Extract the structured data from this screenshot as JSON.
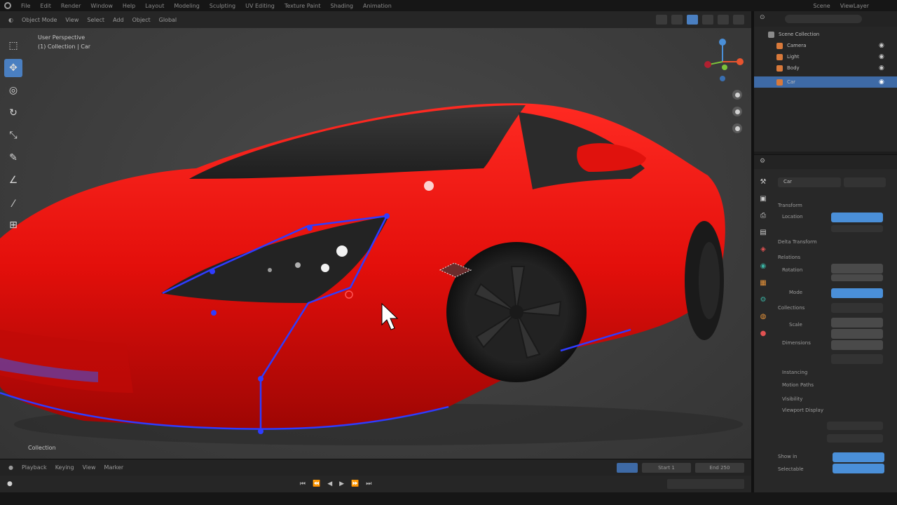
{
  "app": {
    "accent": "#4a8fd8",
    "active_tool": "select-box"
  },
  "topbar": {
    "menus": [
      "File",
      "Edit",
      "Render",
      "Window",
      "Help",
      "Layout",
      "Modeling",
      "Sculpting",
      "UV Editing",
      "Texture Paint",
      "Shading",
      "Animation"
    ],
    "scene_label": "Scene",
    "view_layer_label": "ViewLayer"
  },
  "viewport_header": {
    "menus": [
      "Object Mode",
      "View",
      "Select",
      "Add",
      "Object",
      "Global"
    ]
  },
  "viewport": {
    "info_line1": "User Perspective",
    "info_line2": "(1) Collection | Car",
    "footer_label": "Collection"
  },
  "toolbar": {
    "tools": [
      {
        "name": "select-box",
        "glyph": "⬚"
      },
      {
        "name": "cursor",
        "glyph": "✥"
      },
      {
        "name": "move",
        "glyph": "◎"
      },
      {
        "name": "rotate",
        "glyph": "↻"
      },
      {
        "name": "scale",
        "glyph": "⤡"
      },
      {
        "name": "transform",
        "glyph": "✎"
      },
      {
        "name": "annotate",
        "glyph": "∠"
      },
      {
        "name": "measure",
        "glyph": "⁄"
      },
      {
        "name": "add-cube",
        "glyph": "⊞"
      }
    ]
  },
  "timeline": {
    "labels": [
      "Playback",
      "Keying",
      "View",
      "Marker"
    ],
    "frame_start": "Start 1",
    "frame_end": "End 250"
  },
  "outliner": {
    "items": [
      {
        "label": "Scene Collection",
        "selected": false
      },
      {
        "label": "Camera",
        "selected": false
      },
      {
        "label": "Light",
        "selected": false
      },
      {
        "label": "Body",
        "selected": false
      },
      {
        "label": "Car",
        "selected": true
      }
    ]
  },
  "properties": {
    "header": "Car",
    "sections": [
      "Transform",
      "Delta Transform",
      "Relations",
      "Collections",
      "Instancing",
      "Motion Paths",
      "Visibility",
      "Viewport Display"
    ],
    "fields": [
      {
        "label": "Location",
        "style": "blue"
      },
      {
        "label": "Rotation",
        "style": "normal"
      },
      {
        "label": "Mode",
        "style": "blue"
      },
      {
        "label": "Scale",
        "style": "normal"
      },
      {
        "label": "Dimensions",
        "style": "normal"
      },
      {
        "label": "Show in",
        "style": "blue"
      },
      {
        "label": "Selectable",
        "style": "blue"
      }
    ]
  }
}
